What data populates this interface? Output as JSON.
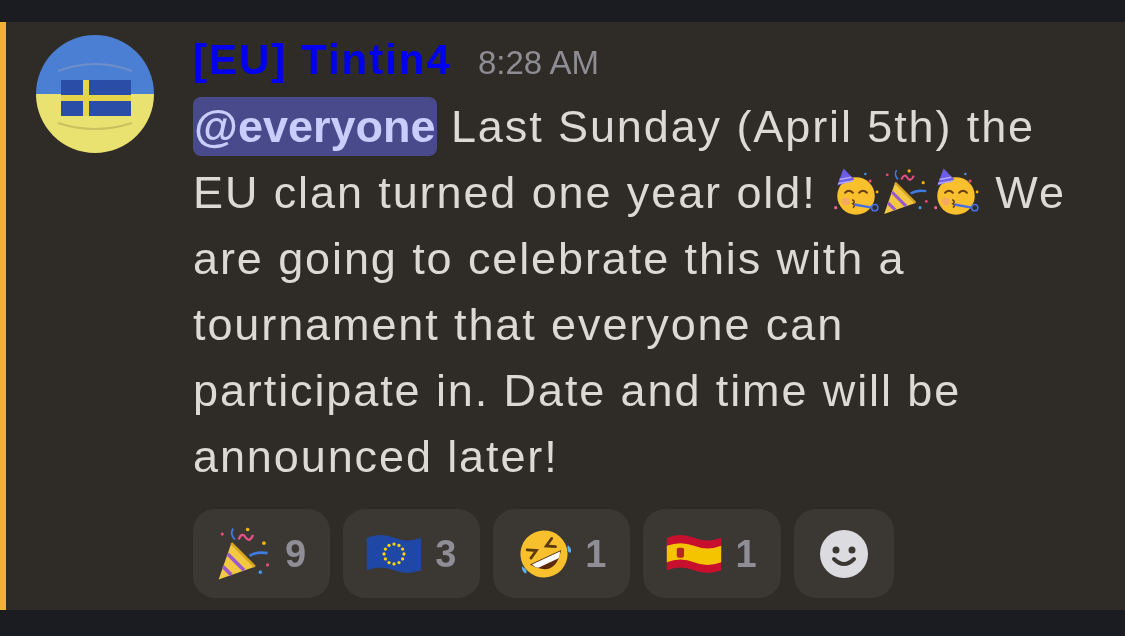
{
  "message": {
    "highlighted": true,
    "author": "[EU] Tintin4",
    "timestamp": "8:28 AM",
    "content": [
      {
        "kind": "mention",
        "text": "@everyone"
      },
      {
        "kind": "text",
        "text": " Last Sunday (April 5th) the EU clan turned one year old! "
      },
      {
        "kind": "partying"
      },
      {
        "kind": "popper"
      },
      {
        "kind": "partying"
      },
      {
        "kind": "text",
        "text": " We are going to celebrate this with a tournament that everyone can participate in. Date and time will be announced later!"
      }
    ],
    "reactions": [
      {
        "kind": "popper",
        "count": "9",
        "selected": false
      },
      {
        "kind": "euflag",
        "count": "3",
        "selected": false
      },
      {
        "kind": "laughing",
        "count": "1",
        "selected": false
      },
      {
        "kind": "spainflag",
        "count": "1",
        "selected": false
      }
    ]
  }
}
